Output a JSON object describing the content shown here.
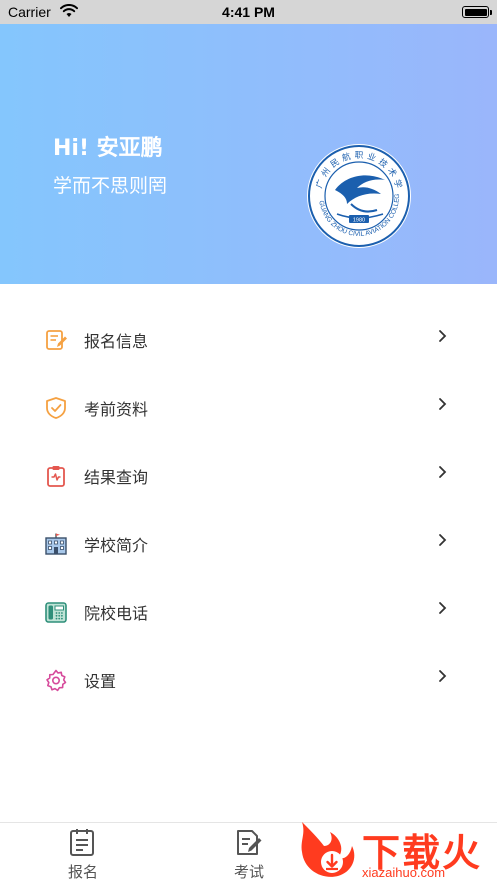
{
  "status_bar": {
    "carrier": "Carrier",
    "time": "4:41 PM"
  },
  "header": {
    "greeting": "Hi! 安亚鹏",
    "motto": "学而不思则罔",
    "logo": {
      "ring_text": "GUANG ZHOU CIVIL AVIATION COLLEGE",
      "year": "1980",
      "top_text": "广州民航职业技术学院"
    }
  },
  "menu": {
    "items": [
      {
        "label": "报名信息",
        "icon": "edit-document-icon"
      },
      {
        "label": "考前资料",
        "icon": "shield-check-icon"
      },
      {
        "label": "结果查询",
        "icon": "clipboard-icon"
      },
      {
        "label": "学校简介",
        "icon": "school-building-icon"
      },
      {
        "label": "院校电话",
        "icon": "telephone-icon"
      },
      {
        "label": "设置",
        "icon": "gear-icon"
      }
    ]
  },
  "tabbar": {
    "tabs": [
      {
        "label": "报名",
        "icon": "register-tab-icon"
      },
      {
        "label": "考试",
        "icon": "exam-tab-icon"
      }
    ]
  },
  "watermark": {
    "text": "下载火",
    "url": "xiazaihuo.com"
  },
  "colors": {
    "header_gradient_start": "#84c6fd",
    "header_gradient_end": "#9ab6fb",
    "icon_orange": "#f5a142",
    "icon_red": "#e4574f",
    "icon_teal": "#2f8f7a",
    "icon_pink": "#d64a9b",
    "logo_blue": "#1b5fae",
    "watermark_red": "#ff3b1f"
  }
}
